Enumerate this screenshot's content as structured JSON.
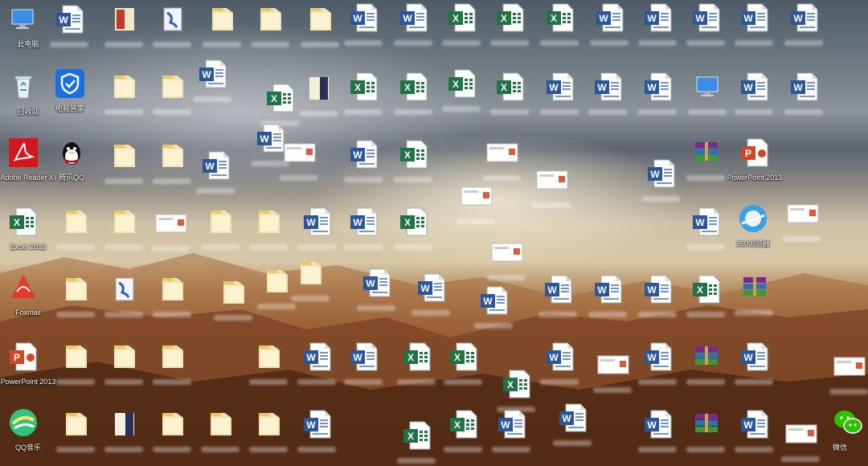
{
  "desktop": {
    "labels": {
      "this_pc": "此电脑",
      "recycle_bin": "回收站",
      "pc_manager": "电脑管家",
      "adobe_reader": "Adobe Reader XI",
      "tencent_qq": "腾讯QQ",
      "excel": "Excel 2013",
      "foxmail": "Foxmail",
      "powerpoint": "PowerPoint 2013",
      "powerpoint_short": "PowerPoint 2013",
      "browser": "360浏览器",
      "qq_music": "QQ音乐",
      "wechat": "微信"
    }
  }
}
